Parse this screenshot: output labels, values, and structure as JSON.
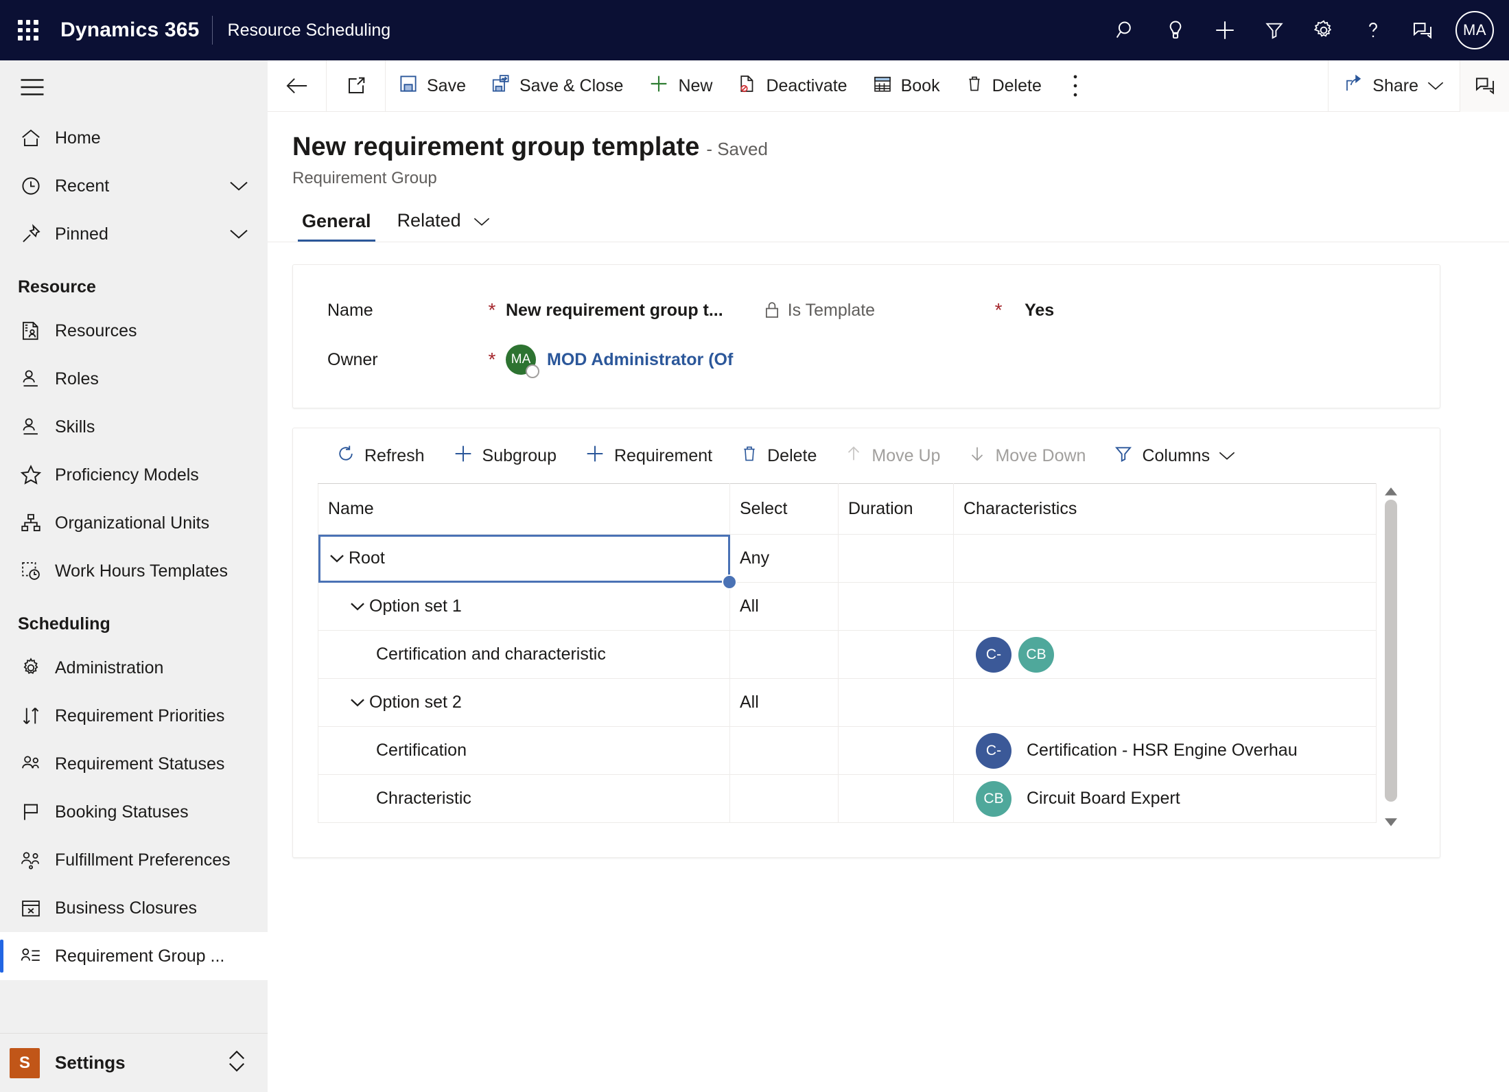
{
  "topnav": {
    "waffle_icon": "app-launcher-icon",
    "brand": "Dynamics 365",
    "app_name": "Resource Scheduling",
    "icons": [
      "search-icon",
      "lightbulb-icon",
      "quick-create-icon",
      "filter-icon",
      "gear-icon",
      "help-icon",
      "feedback-icon"
    ],
    "avatar_initials": "MA",
    "background": "#0b1034"
  },
  "sidebar": {
    "hamburger_icon": "hamburger-menu-icon",
    "top_items": [
      {
        "label": "Home",
        "icon": "home-icon",
        "chevron": false
      },
      {
        "label": "Recent",
        "icon": "clock-icon",
        "chevron": true
      },
      {
        "label": "Pinned",
        "icon": "pin-icon",
        "chevron": true
      }
    ],
    "groups": [
      {
        "title": "Resource",
        "items": [
          {
            "label": "Resources",
            "icon": "resource-card-icon"
          },
          {
            "label": "Roles",
            "icon": "person-line-icon"
          },
          {
            "label": "Skills",
            "icon": "person-line-icon"
          },
          {
            "label": "Proficiency Models",
            "icon": "star-icon"
          },
          {
            "label": "Organizational Units",
            "icon": "org-chart-icon"
          },
          {
            "label": "Work Hours Templates",
            "icon": "work-hours-icon"
          }
        ]
      },
      {
        "title": "Scheduling",
        "items": [
          {
            "label": "Administration",
            "icon": "gear-icon"
          },
          {
            "label": "Requirement Priorities",
            "icon": "sort-arrows-icon"
          },
          {
            "label": "Requirement Statuses",
            "icon": "people-status-icon"
          },
          {
            "label": "Booking Statuses",
            "icon": "flag-icon"
          },
          {
            "label": "Fulfillment Preferences",
            "icon": "people-gear-icon"
          },
          {
            "label": "Business Closures",
            "icon": "calendar-x-icon"
          },
          {
            "label": "Requirement Group ...",
            "icon": "person-list-icon",
            "selected": true
          }
        ]
      }
    ],
    "footer": {
      "tile_letter": "S",
      "label": "Settings",
      "tile_color": "#c15618",
      "chevron_icon": "updown-chevron-icon"
    },
    "selected_accent": "#2266e3"
  },
  "commandbar": {
    "back_icon": "back-arrow-icon",
    "popout_icon": "popout-window-icon",
    "buttons": [
      {
        "label": "Save",
        "icon": "save-disk-icon"
      },
      {
        "label": "Save & Close",
        "icon": "save-close-icon"
      },
      {
        "label": "New",
        "icon": "plus-icon"
      },
      {
        "label": "Deactivate",
        "icon": "deactivate-icon"
      },
      {
        "label": "Book",
        "icon": "calendar-icon"
      },
      {
        "label": "Delete",
        "icon": "trash-icon"
      }
    ],
    "overflow_icon": "more-vertical-icon",
    "share": {
      "label": "Share",
      "icon": "share-icon",
      "chevron_icon": "chevron-down-icon"
    },
    "panel_icon": "side-panel-icon"
  },
  "page": {
    "title": "New requirement group template",
    "saved_status": "- Saved",
    "subtitle": "Requirement Group",
    "tabs": [
      {
        "label": "General",
        "active": true,
        "chevron": false
      },
      {
        "label": "Related",
        "active": false,
        "chevron": true
      }
    ]
  },
  "form": {
    "fields": [
      {
        "label": "Name",
        "required": "*",
        "value": "New requirement group t...",
        "type": "text"
      },
      {
        "label": "Is Template",
        "required": "*",
        "value": "Yes",
        "type": "locked",
        "icon": "lock-icon"
      },
      {
        "label": "Owner",
        "required": "*",
        "value": "MOD Administrator (Of",
        "type": "lookup",
        "avatar_initials": "MA",
        "avatar_color": "#2d7331"
      }
    ]
  },
  "grid": {
    "toolbar": [
      {
        "label": "Refresh",
        "icon": "refresh-icon",
        "disabled": false
      },
      {
        "label": "Subgroup",
        "icon": "plus-icon",
        "disabled": false
      },
      {
        "label": "Requirement",
        "icon": "plus-icon",
        "disabled": false
      },
      {
        "label": "Delete",
        "icon": "trash-icon",
        "disabled": false
      },
      {
        "label": "Move Up",
        "icon": "arrow-up-icon",
        "disabled": true
      },
      {
        "label": "Move Down",
        "icon": "arrow-down-icon",
        "disabled": true
      },
      {
        "label": "Columns",
        "icon": "filter-icon",
        "disabled": false,
        "chevron": true
      }
    ],
    "columns": [
      "Name",
      "Select",
      "Duration",
      "Characteristics"
    ],
    "rows": [
      {
        "name": "Root",
        "indent": 0,
        "caret": true,
        "select": "Any",
        "duration": "",
        "characteristics": [],
        "selected": true
      },
      {
        "name": "Option set 1",
        "indent": 1,
        "caret": true,
        "select": "All",
        "duration": "",
        "characteristics": [],
        "selected": false
      },
      {
        "name": "Certification and characteristic",
        "indent": 2,
        "caret": false,
        "select": "",
        "duration": "",
        "characteristics": [
          {
            "initials": "C-",
            "color": "#3b5998",
            "label": ""
          },
          {
            "initials": "CB",
            "color": "#4fa89b",
            "label": ""
          }
        ],
        "selected": false
      },
      {
        "name": "Option set 2",
        "indent": 1,
        "caret": true,
        "select": "All",
        "duration": "",
        "characteristics": [],
        "selected": false
      },
      {
        "name": "Certification",
        "indent": 2,
        "caret": false,
        "select": "",
        "duration": "",
        "characteristics": [
          {
            "initials": "C-",
            "color": "#3b5998",
            "label": "Certification - HSR Engine Overhau"
          }
        ],
        "selected": false
      },
      {
        "name": "Chracteristic",
        "indent": 2,
        "caret": false,
        "select": "",
        "duration": "",
        "characteristics": [
          {
            "initials": "CB",
            "color": "#4fa89b",
            "label": "Circuit Board Expert"
          }
        ],
        "selected": false
      }
    ],
    "scrollbar": {
      "up_icon": "scroll-up-icon",
      "down_icon": "scroll-down-icon"
    }
  }
}
